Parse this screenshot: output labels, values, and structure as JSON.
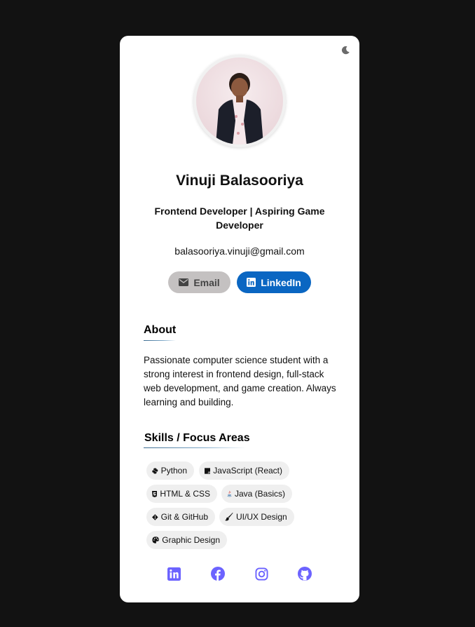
{
  "profile": {
    "name": "Vinuji Balasooriya",
    "title": "Frontend Developer | Aspiring Game Developer",
    "email": "balasooriya.vinuji@gmail.com"
  },
  "buttons": {
    "email_label": "Email",
    "linkedin_label": "LinkedIn"
  },
  "about": {
    "heading": "About",
    "text": "Passionate computer science student with a strong interest in frontend design, full-stack web development, and game creation. Always learning and building."
  },
  "skills": {
    "heading": "Skills / Focus Areas",
    "items": [
      {
        "label": "Python",
        "icon": "python-icon"
      },
      {
        "label": "JavaScript (React)",
        "icon": "javascript-icon"
      },
      {
        "label": "HTML & CSS",
        "icon": "html5-icon"
      },
      {
        "label": "Java (Basics)",
        "icon": "java-icon"
      },
      {
        "label": "Git & GitHub",
        "icon": "git-icon"
      },
      {
        "label": "UI/UX Design",
        "icon": "brush-icon"
      },
      {
        "label": "Graphic Design",
        "icon": "palette-icon"
      }
    ]
  },
  "social": [
    "linkedin-icon",
    "facebook-icon",
    "instagram-icon",
    "github-icon"
  ],
  "colors": {
    "background": "#121212",
    "card": "#ffffff",
    "linkedin": "#0a66c2",
    "email_button": "#c4c1c1",
    "social_icons": "#6c63ff",
    "chip": "#efefef"
  }
}
